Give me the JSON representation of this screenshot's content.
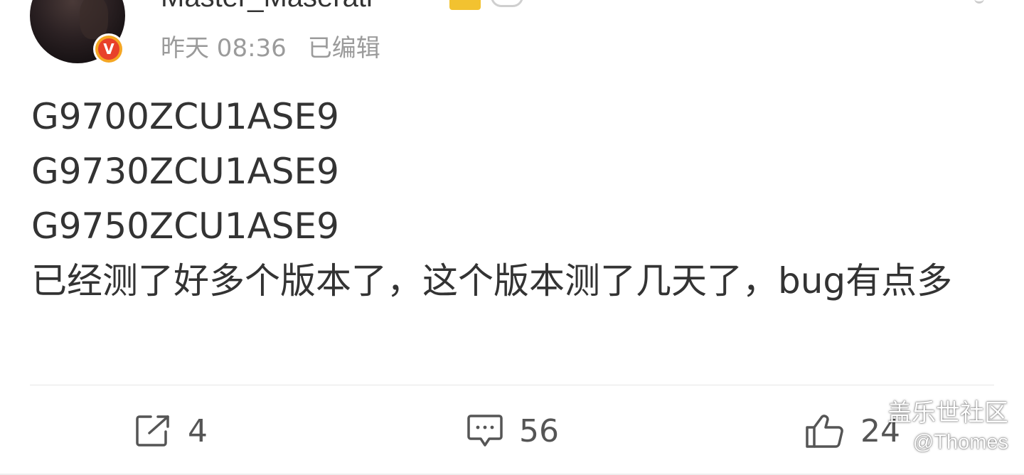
{
  "header": {
    "username": "Master_Maserati",
    "time": "昨天 08:36",
    "edited_label": "已编辑",
    "badge_letter": "V"
  },
  "post": {
    "lines": [
      "G9700ZCU1ASE9",
      "G9730ZCU1ASE9",
      "G9750ZCU1ASE9"
    ],
    "text": "已经测了好多个版本了，这个版本测了几天了，bug有点多"
  },
  "actions": {
    "repost_count": "4",
    "comment_count": "56",
    "like_count": "24"
  },
  "watermark": {
    "site": "盖乐世社区",
    "user": "@Thomes"
  },
  "colors": {
    "text": "#333333",
    "meta": "#9b9b9b",
    "badge_red": "#e8412a",
    "badge_gold": "#f5a623",
    "divider": "#e6e6e6"
  }
}
